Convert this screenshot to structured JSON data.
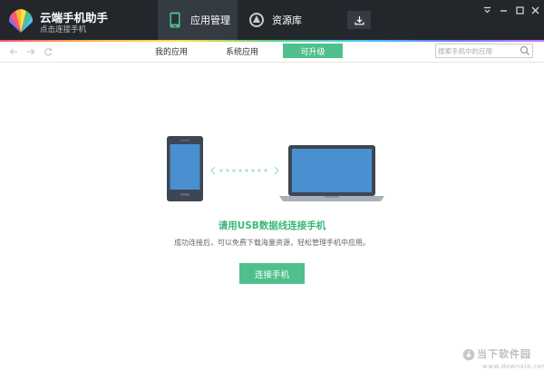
{
  "app": {
    "name": "云端手机助手",
    "subtitle": "点击连接手机"
  },
  "tabs": [
    {
      "label": "应用管理",
      "icon": "phone-icon",
      "active": true
    },
    {
      "label": "资源库",
      "icon": "resource-icon",
      "active": false
    }
  ],
  "toolbar": {
    "download_icon": "download-icon"
  },
  "window_controls": [
    "menu-icon",
    "minimize-icon",
    "maximize-icon",
    "close-icon"
  ],
  "nav": {
    "back_icon": "back-arrow-icon",
    "forward_icon": "forward-arrow-icon",
    "refresh_icon": "refresh-icon"
  },
  "subtabs": [
    {
      "label": "我的应用",
      "active": false
    },
    {
      "label": "系统应用",
      "active": false
    },
    {
      "label": "可升级",
      "active": true
    }
  ],
  "search": {
    "placeholder": "搜索手机中的应用"
  },
  "main": {
    "title": "请用USB数据线连接手机",
    "description": "成功连接后，可以免费下载海量资源，轻松管理手机中应用。",
    "connect_button": "连接手机"
  },
  "watermark": {
    "title": "当下软件园",
    "subtitle": "www.downxia.com"
  },
  "colors": {
    "titlebar": "#23272c",
    "accent": "#4fc08d",
    "title_green": "#3cb878",
    "device_blue": "#4a8fd0",
    "device_frame": "#3d4652"
  }
}
